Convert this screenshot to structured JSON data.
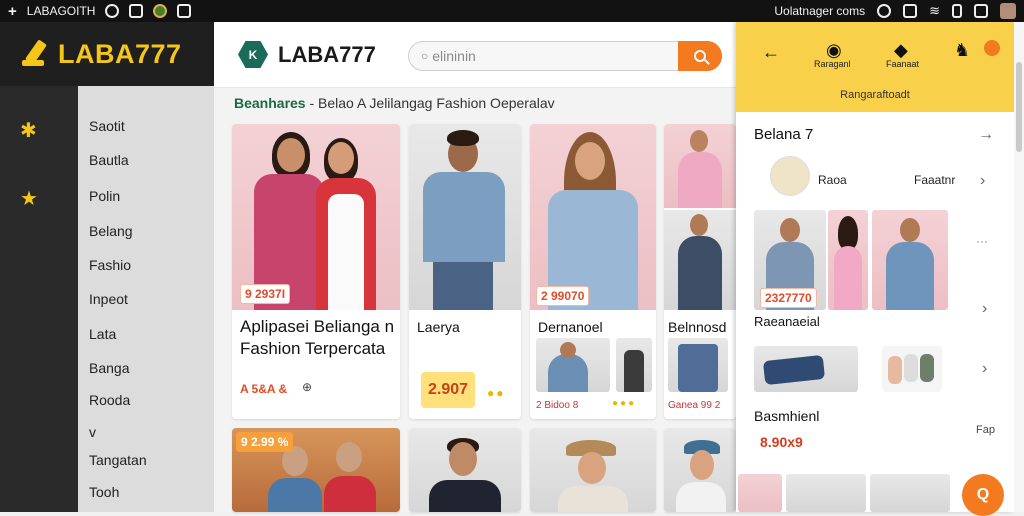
{
  "status_bar": {
    "app_label": "LABAGOITH",
    "right_text": "Uolatnager  coms"
  },
  "brand": {
    "name": "LABA777"
  },
  "sidebar": {
    "items": [
      "Saotit",
      "Bautla",
      "Polin",
      "Belang",
      "Fashio",
      "Inpeot",
      "Lata",
      "Banga",
      "Rooda",
      "v",
      "Tangatan",
      "Tooh"
    ]
  },
  "header": {
    "logo_text": "LABA777",
    "logo_mark": "K",
    "search_placeholder": "elininin"
  },
  "breadcrumb": {
    "lead": "Beanhares",
    "rest": " - Belao A Jelilangag Fashion  Oeperalav"
  },
  "cards": {
    "hero": {
      "price": "9 2937I",
      "title": "Aplipasei Belianga n Fashion Terpercata",
      "meta": "A 5&A &"
    },
    "card2": {
      "title": "Laerya",
      "price": "2.907"
    },
    "card3": {
      "price": "2 99070",
      "title": "Dernanoel",
      "meta": "2 Bidoo  8"
    },
    "card4": {
      "title": "Belnnosd",
      "meta": "Ganea 99 2"
    },
    "row2a": {
      "price": "9 2.99 %"
    }
  },
  "panel": {
    "actions": [
      {
        "label": "Raraganl"
      },
      {
        "label": "Faanaat"
      }
    ],
    "subtitle": "Rangaraftoadt",
    "section1": "Belana 7",
    "profile_name": "Raoa",
    "profile_action": "Faaatnr",
    "featured_price": "2327770",
    "section2": "Raeanaeial",
    "section3": "Basmhienl",
    "price3": "8.90x9",
    "more_label": "Fap"
  },
  "colors": {
    "accent": "#f47a1f",
    "brand_yellow": "#f5c518",
    "panel_yellow": "#f8d04a"
  }
}
